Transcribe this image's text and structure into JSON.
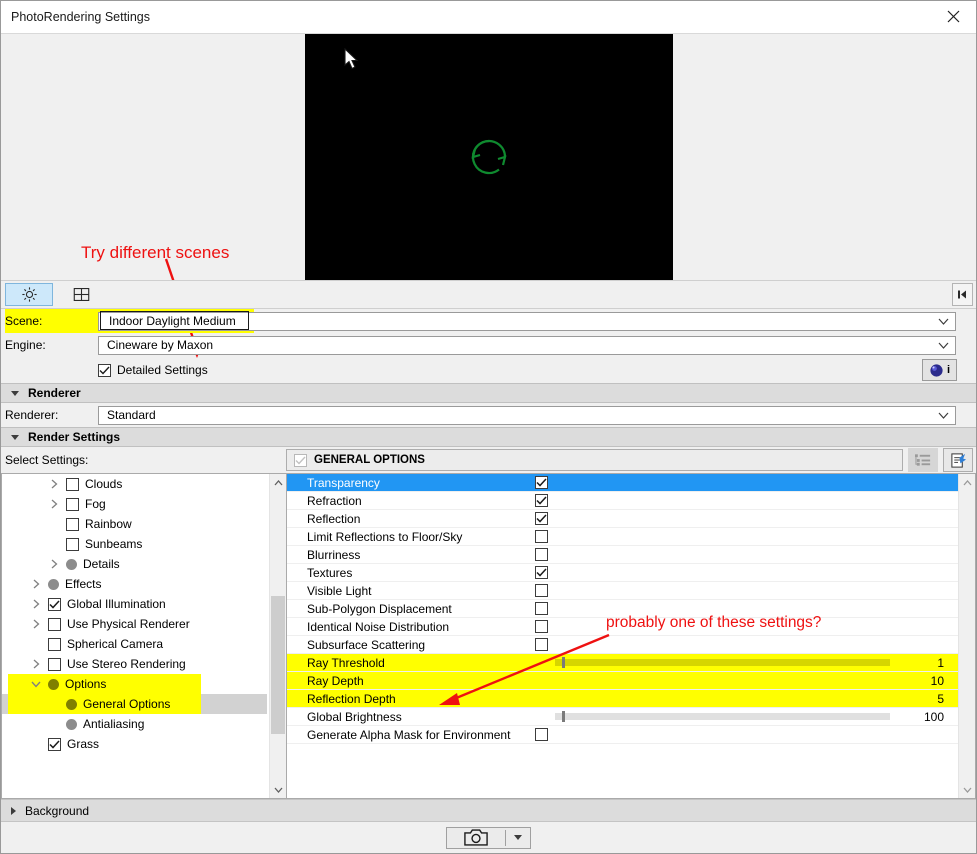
{
  "window": {
    "title": "PhotoRendering Settings",
    "close_label": "✕"
  },
  "preview": {
    "spinner_icon": "refresh-spinner-icon",
    "background_color": "#000000",
    "spinner_color": "#0f8a2f"
  },
  "annotations": [
    {
      "text": "Try different scenes",
      "color": "#ee1111"
    },
    {
      "text": "probably one of these settings?",
      "color": "#ee1111"
    }
  ],
  "tabs": [
    {
      "name": "settings-tab",
      "icon": "gear-icon",
      "active": true
    },
    {
      "name": "layout-tab",
      "icon": "grid-frame-icon",
      "active": false
    }
  ],
  "tabstrip": {
    "scroll_icon": "scroll-right-icon"
  },
  "form": {
    "scene": {
      "label": "Scene:",
      "value": "Indoor Daylight Medium",
      "highlighted": true
    },
    "engine": {
      "label": "Engine:",
      "value": "Cineware by Maxon"
    },
    "detailed_settings": {
      "label": "Detailed Settings",
      "checked": true
    },
    "info_button": {
      "icon": "sphere-icon",
      "label": "i"
    }
  },
  "sections": {
    "renderer": {
      "title": "Renderer",
      "expanded": true
    },
    "render_settings": {
      "title": "Render Settings",
      "expanded": true
    },
    "background": {
      "title": "Background",
      "expanded": false
    }
  },
  "renderer": {
    "label": "Renderer:",
    "value": "Standard"
  },
  "select_settings": {
    "label": "Select Settings:"
  },
  "tree": {
    "items": [
      {
        "label": "Clouds",
        "indent": 2,
        "marker": "checkbox",
        "checked": false,
        "arrow": "right"
      },
      {
        "label": "Fog",
        "indent": 2,
        "marker": "checkbox",
        "checked": false,
        "arrow": "right"
      },
      {
        "label": "Rainbow",
        "indent": 2,
        "marker": "checkbox",
        "checked": false,
        "arrow": "none"
      },
      {
        "label": "Sunbeams",
        "indent": 2,
        "marker": "checkbox",
        "checked": false,
        "arrow": "none"
      },
      {
        "label": "Details",
        "indent": 2,
        "marker": "dot",
        "arrow": "right"
      },
      {
        "label": "Effects",
        "indent": 1,
        "marker": "dot",
        "arrow": "right"
      },
      {
        "label": "Global Illumination",
        "indent": 1,
        "marker": "checkbox",
        "checked": true,
        "arrow": "right"
      },
      {
        "label": "Use Physical Renderer",
        "indent": 1,
        "marker": "checkbox",
        "checked": false,
        "arrow": "right"
      },
      {
        "label": "Spherical Camera",
        "indent": 1,
        "marker": "checkbox",
        "checked": false,
        "arrow": "none"
      },
      {
        "label": "Use Stereo Rendering",
        "indent": 1,
        "marker": "checkbox",
        "checked": false,
        "arrow": "right"
      },
      {
        "label": "Options",
        "indent": 1,
        "marker": "dot-olive",
        "arrow": "down",
        "highlight": true
      },
      {
        "label": "General Options",
        "indent": 2,
        "marker": "dot-olive",
        "arrow": "none",
        "highlight": true,
        "selected": true
      },
      {
        "label": "Antialiasing",
        "indent": 2,
        "marker": "dot",
        "arrow": "none"
      },
      {
        "label": "Grass",
        "indent": 1,
        "marker": "checkbox",
        "checked": true,
        "arrow": "none"
      }
    ]
  },
  "options_panel": {
    "header": {
      "title": "GENERAL OPTIONS",
      "checkbox_checked": false,
      "checkbox_disabled": true
    },
    "buttons": [
      {
        "name": "list-view-button",
        "icon": "bullet-list-icon"
      },
      {
        "name": "export-settings-button",
        "icon": "document-export-icon"
      }
    ],
    "rows": [
      {
        "label": "Transparency",
        "type": "checkbox",
        "checked": true,
        "selected": true
      },
      {
        "label": "Refraction",
        "type": "checkbox",
        "checked": true
      },
      {
        "label": "Reflection",
        "type": "checkbox",
        "checked": true
      },
      {
        "label": "Limit Reflections to Floor/Sky",
        "type": "checkbox",
        "checked": false
      },
      {
        "label": "Blurriness",
        "type": "checkbox",
        "checked": false
      },
      {
        "label": "Textures",
        "type": "checkbox",
        "checked": true
      },
      {
        "label": "Visible Light",
        "type": "checkbox",
        "checked": false
      },
      {
        "label": "Sub-Polygon Displacement",
        "type": "checkbox",
        "checked": false
      },
      {
        "label": "Identical Noise Distribution",
        "type": "checkbox",
        "checked": false
      },
      {
        "label": "Subsurface Scattering",
        "type": "checkbox",
        "checked": false
      },
      {
        "label": "Ray Threshold",
        "type": "slider",
        "value": "1",
        "fill_percent": 2,
        "highlight": true
      },
      {
        "label": "Ray Depth",
        "type": "value",
        "value": "10",
        "highlight": true
      },
      {
        "label": "Reflection Depth",
        "type": "value",
        "value": "5",
        "highlight": true
      },
      {
        "label": "Global Brightness",
        "type": "slider",
        "value": "100",
        "fill_percent": 2
      },
      {
        "label": "Generate Alpha Mask for Environment",
        "type": "checkbox",
        "checked": false
      }
    ]
  },
  "bottom": {
    "camera_button": {
      "icon": "camera-icon"
    },
    "camera_dropdown": {
      "icon": "chevron-down-icon"
    }
  },
  "colors": {
    "highlight_yellow": "#ffff00",
    "selection_blue": "#2196f3",
    "annotation_red": "#ee1111"
  }
}
